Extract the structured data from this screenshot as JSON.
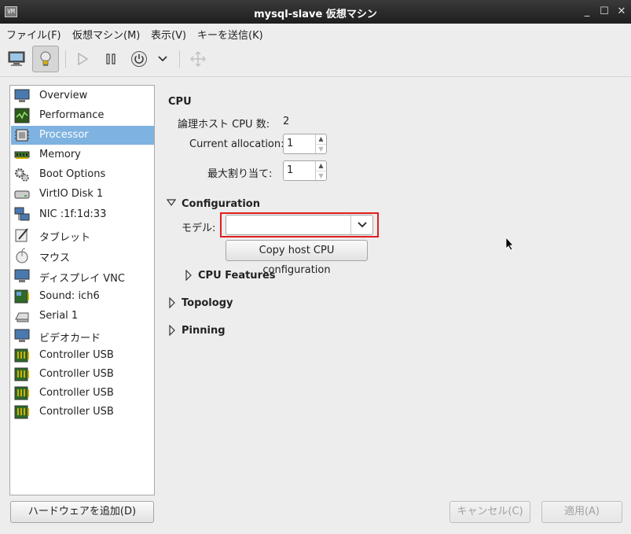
{
  "window": {
    "title": "mysql-slave 仮想マシン",
    "app_icon_text": "VM",
    "minimize": "_",
    "maximize": "☐",
    "close": "✕"
  },
  "menu": {
    "items": [
      "ファイル(F)",
      "仮想マシン(M)",
      "表示(V)",
      "キーを送信(K)"
    ]
  },
  "toolbar": {
    "buttons": [
      "console-icon",
      "details-icon",
      "run-icon",
      "pause-icon",
      "shutdown-icon",
      "shutdown-menu-icon",
      "fullscreen-icon"
    ]
  },
  "sidebar": {
    "items": [
      {
        "label": "Overview",
        "icon": "monitor-icon"
      },
      {
        "label": "Performance",
        "icon": "chart-icon"
      },
      {
        "label": "Processor",
        "icon": "cpu-icon",
        "selected": true
      },
      {
        "label": "Memory",
        "icon": "memory-icon"
      },
      {
        "label": "Boot Options",
        "icon": "gear-icon"
      },
      {
        "label": "VirtIO Disk 1",
        "icon": "disk-icon"
      },
      {
        "label": "NIC :1f:1d:33",
        "icon": "network-icon"
      },
      {
        "label": "タブレット",
        "icon": "tablet-icon"
      },
      {
        "label": "マウス",
        "icon": "mouse-icon"
      },
      {
        "label": "ディスプレイ VNC",
        "icon": "display-icon"
      },
      {
        "label": "Sound: ich6",
        "icon": "sound-icon"
      },
      {
        "label": "Serial 1",
        "icon": "serial-icon"
      },
      {
        "label": "ビデオカード",
        "icon": "video-icon"
      },
      {
        "label": "Controller USB",
        "icon": "usb-icon"
      },
      {
        "label": "Controller USB",
        "icon": "usb-icon"
      },
      {
        "label": "Controller USB",
        "icon": "usb-icon"
      },
      {
        "label": "Controller USB",
        "icon": "usb-icon"
      }
    ],
    "selected_color": "#7eb2e0"
  },
  "add_hardware_label": "ハードウェアを追加(D)",
  "cpu": {
    "section_title": "CPU",
    "logical_cpus_label": "論理ホスト CPU 数:",
    "logical_cpus_value": "2",
    "current_alloc_label": "Current allocation:",
    "current_alloc_value": "1",
    "max_alloc_label": "最大割り当て:",
    "max_alloc_value": "1"
  },
  "configuration": {
    "title": "Configuration",
    "model_label": "モデル:",
    "model_value": "",
    "copy_button": "Copy host CPU configuration",
    "cpu_features": "CPU Features",
    "highlight_color": "#e11e1e"
  },
  "topology": {
    "title": "Topology"
  },
  "pinning": {
    "title": "Pinning"
  },
  "footer": {
    "cancel": "キャンセル(C)",
    "apply": "適用(A)"
  }
}
